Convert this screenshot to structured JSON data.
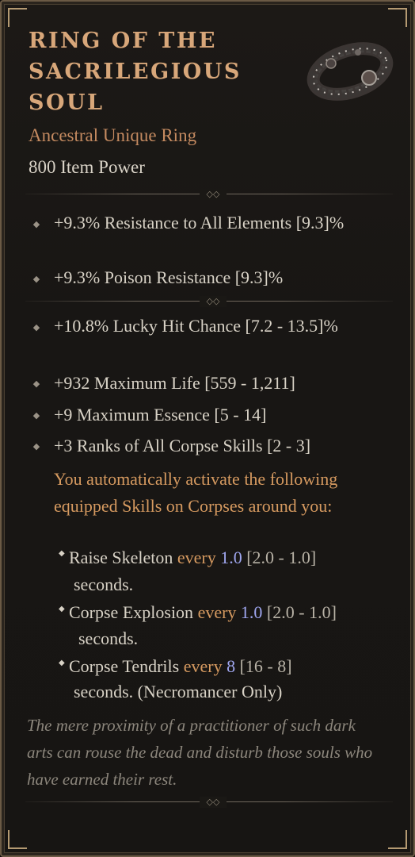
{
  "item": {
    "name": "RING OF THE SACRILEGIOUS SOUL",
    "type": "Ancestral Unique Ring",
    "power": "800 Item Power",
    "icon": "ring-icon"
  },
  "implicits": [
    {
      "text": "+9.3% Resistance to All Elements [9.3]%"
    },
    {
      "text": "+9.3% Poison Resistance [9.3]%"
    }
  ],
  "affixes": [
    {
      "text": "+10.8% Lucky Hit Chance [7.2 - 13.5]%"
    },
    {
      "text": "+932 Maximum Life [559 - 1,211]"
    },
    {
      "text": "+9 Maximum Essence [5 - 14]"
    },
    {
      "text": "+3 Ranks of All Corpse Skills [2 - 3]"
    }
  ],
  "unique_power": {
    "text": "You automatically activate the following equipped Skills on Corpses around you:",
    "skills": [
      {
        "name": "Raise Skeleton",
        "every": "every",
        "value": "1.0",
        "range": "[2.0 - 1.0]",
        "tail": "seconds."
      },
      {
        "name": "Corpse Explosion",
        "every": "every",
        "value": "1.0",
        "range": "[2.0 - 1.0]",
        "tail": "seconds."
      },
      {
        "name": "Corpse Tendrils",
        "every": "every",
        "value": "8",
        "range": "[16 - 8]",
        "tail": "seconds. (Necromancer Only)"
      }
    ]
  },
  "flavor": "The mere proximity of a practitioner of such dark arts can rouse the dead and disturb those souls who have earned their rest.",
  "colors": {
    "title": "#d8a77a",
    "unique": "#d69a60",
    "value_blue": "#9fa6ef",
    "text": "#d8d2c6",
    "flavor": "#8c867c"
  }
}
